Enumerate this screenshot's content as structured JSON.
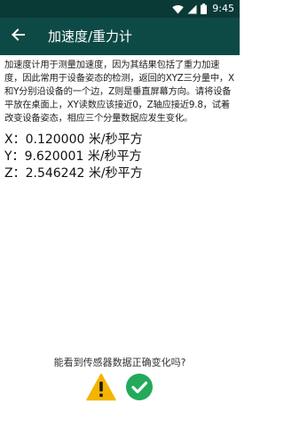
{
  "status_bar": {
    "time": "9:45",
    "icons": [
      "wifi-icon",
      "cellular-signal-icon",
      "battery-icon"
    ]
  },
  "app_bar": {
    "back_icon": "arrow-left-icon",
    "title": "加速度/重力计"
  },
  "description": "加速度计用于测量加速度，因为其结果包括了重力加速度，因此常用于设备姿态的检测，返回的XYZ三分量中，X和Y分别沿设备的一个边，Z则是垂直屏幕方向。请将设备平放在桌面上，XY读数应该接近0，Z轴应接近9.8，试着改变设备姿态，相应三个分量数据应发生变化。",
  "readings": [
    {
      "axis": "X：",
      "value": "0.120000",
      "unit": "米/秒平方"
    },
    {
      "axis": "Y：",
      "value": "9.620001",
      "unit": "米/秒平方"
    },
    {
      "axis": "Z：",
      "value": "2.546242",
      "unit": "米/秒平方"
    }
  ],
  "question": "能看到传感器数据正确变化吗?",
  "actions": {
    "fail_icon": "warning-icon",
    "pass_icon": "check-circle-icon"
  },
  "colors": {
    "status_bar": "#0a3a36",
    "app_bar": "#0d4a45",
    "warning": "#f5b400",
    "success": "#22aa5a"
  }
}
